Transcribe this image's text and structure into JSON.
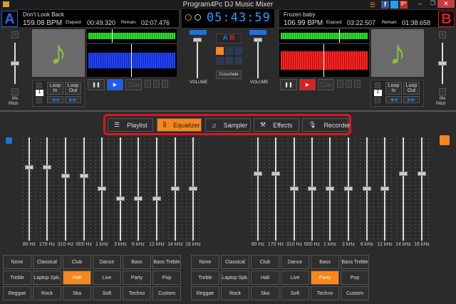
{
  "window": {
    "title": "Program4Pc DJ Music Mixer",
    "icons": [
      "folder-icon",
      "list-icon",
      "facebook-icon",
      "twitter-icon",
      "googleplus-icon",
      "minimize-icon",
      "restore-icon",
      "close-icon"
    ]
  },
  "clock": "05:43:59 PM",
  "deckA": {
    "letter": "A",
    "track": "Don't Look Back",
    "bpm": "159.08 BPM",
    "elapsed_label": "Elapsed",
    "elapsed": "00:49.320",
    "remain_label": "Remain",
    "remain": "02:07.476",
    "pitch": "0%",
    "pitch_label": "Pitch",
    "loop_count": "1",
    "loop_in": "Loop In",
    "loop_out": "Loop Out",
    "cue": "Cue",
    "hotcues": [
      "1",
      "2",
      "3"
    ],
    "color": "#1e6fe0",
    "play_color": "#1e5bff"
  },
  "deckB": {
    "letter": "B",
    "track": "Frozen baby",
    "bpm": "106.99 BPM",
    "elapsed_label": "Elapsed",
    "elapsed": "03:22.507",
    "remain_label": "Remain",
    "remain": "01:38.658",
    "pitch": "0%",
    "pitch_label": "Pitch",
    "loop_count": "1",
    "loop_in": "Loop In",
    "loop_out": "Loop Out",
    "cue": "Cue",
    "hotcues": [
      "1",
      "2",
      "3"
    ],
    "color": "#e01e1e",
    "play_color": "#e01e1e"
  },
  "mixer": {
    "volume_label": "VOLUME",
    "crossfade": "Crossfade",
    "a": "A",
    "b": "B"
  },
  "tabs": [
    {
      "label": "Playlist",
      "icon": "playlist-icon"
    },
    {
      "label": "Equalizer",
      "icon": "equalizer-icon",
      "active": true
    },
    {
      "label": "Sampler",
      "icon": "music-note-icon"
    },
    {
      "label": "Effects",
      "icon": "wand-icon"
    },
    {
      "label": "Recorder",
      "icon": "microphone-icon"
    }
  ],
  "eq": {
    "bands": [
      "80 Hz",
      "170 Hz",
      "310 Hz",
      "600 Hz",
      "1 kHz",
      "3 kHz",
      "6 kHz",
      "12 kHz",
      "14 kHz",
      "16 kHz"
    ],
    "left_levels": [
      0.42,
      0.42,
      0.25,
      0.25,
      0,
      -0.19,
      -0.19,
      -0.19,
      0,
      0
    ],
    "right_levels": [
      0.29,
      0.29,
      0,
      0,
      0,
      0,
      0,
      0,
      0.29,
      0.29
    ]
  },
  "presets": [
    "None",
    "Classical",
    "Club",
    "Dance",
    "Bass",
    "Bass Treble",
    "Treble",
    "Laptop Spk.",
    "Hall",
    "Live",
    "Party",
    "Pop",
    "Reggae",
    "Rock",
    "Ska",
    "Soft",
    "Techno",
    "Custom"
  ],
  "left_selected": "Hall",
  "right_selected": "Party",
  "accent": "#f7871d"
}
